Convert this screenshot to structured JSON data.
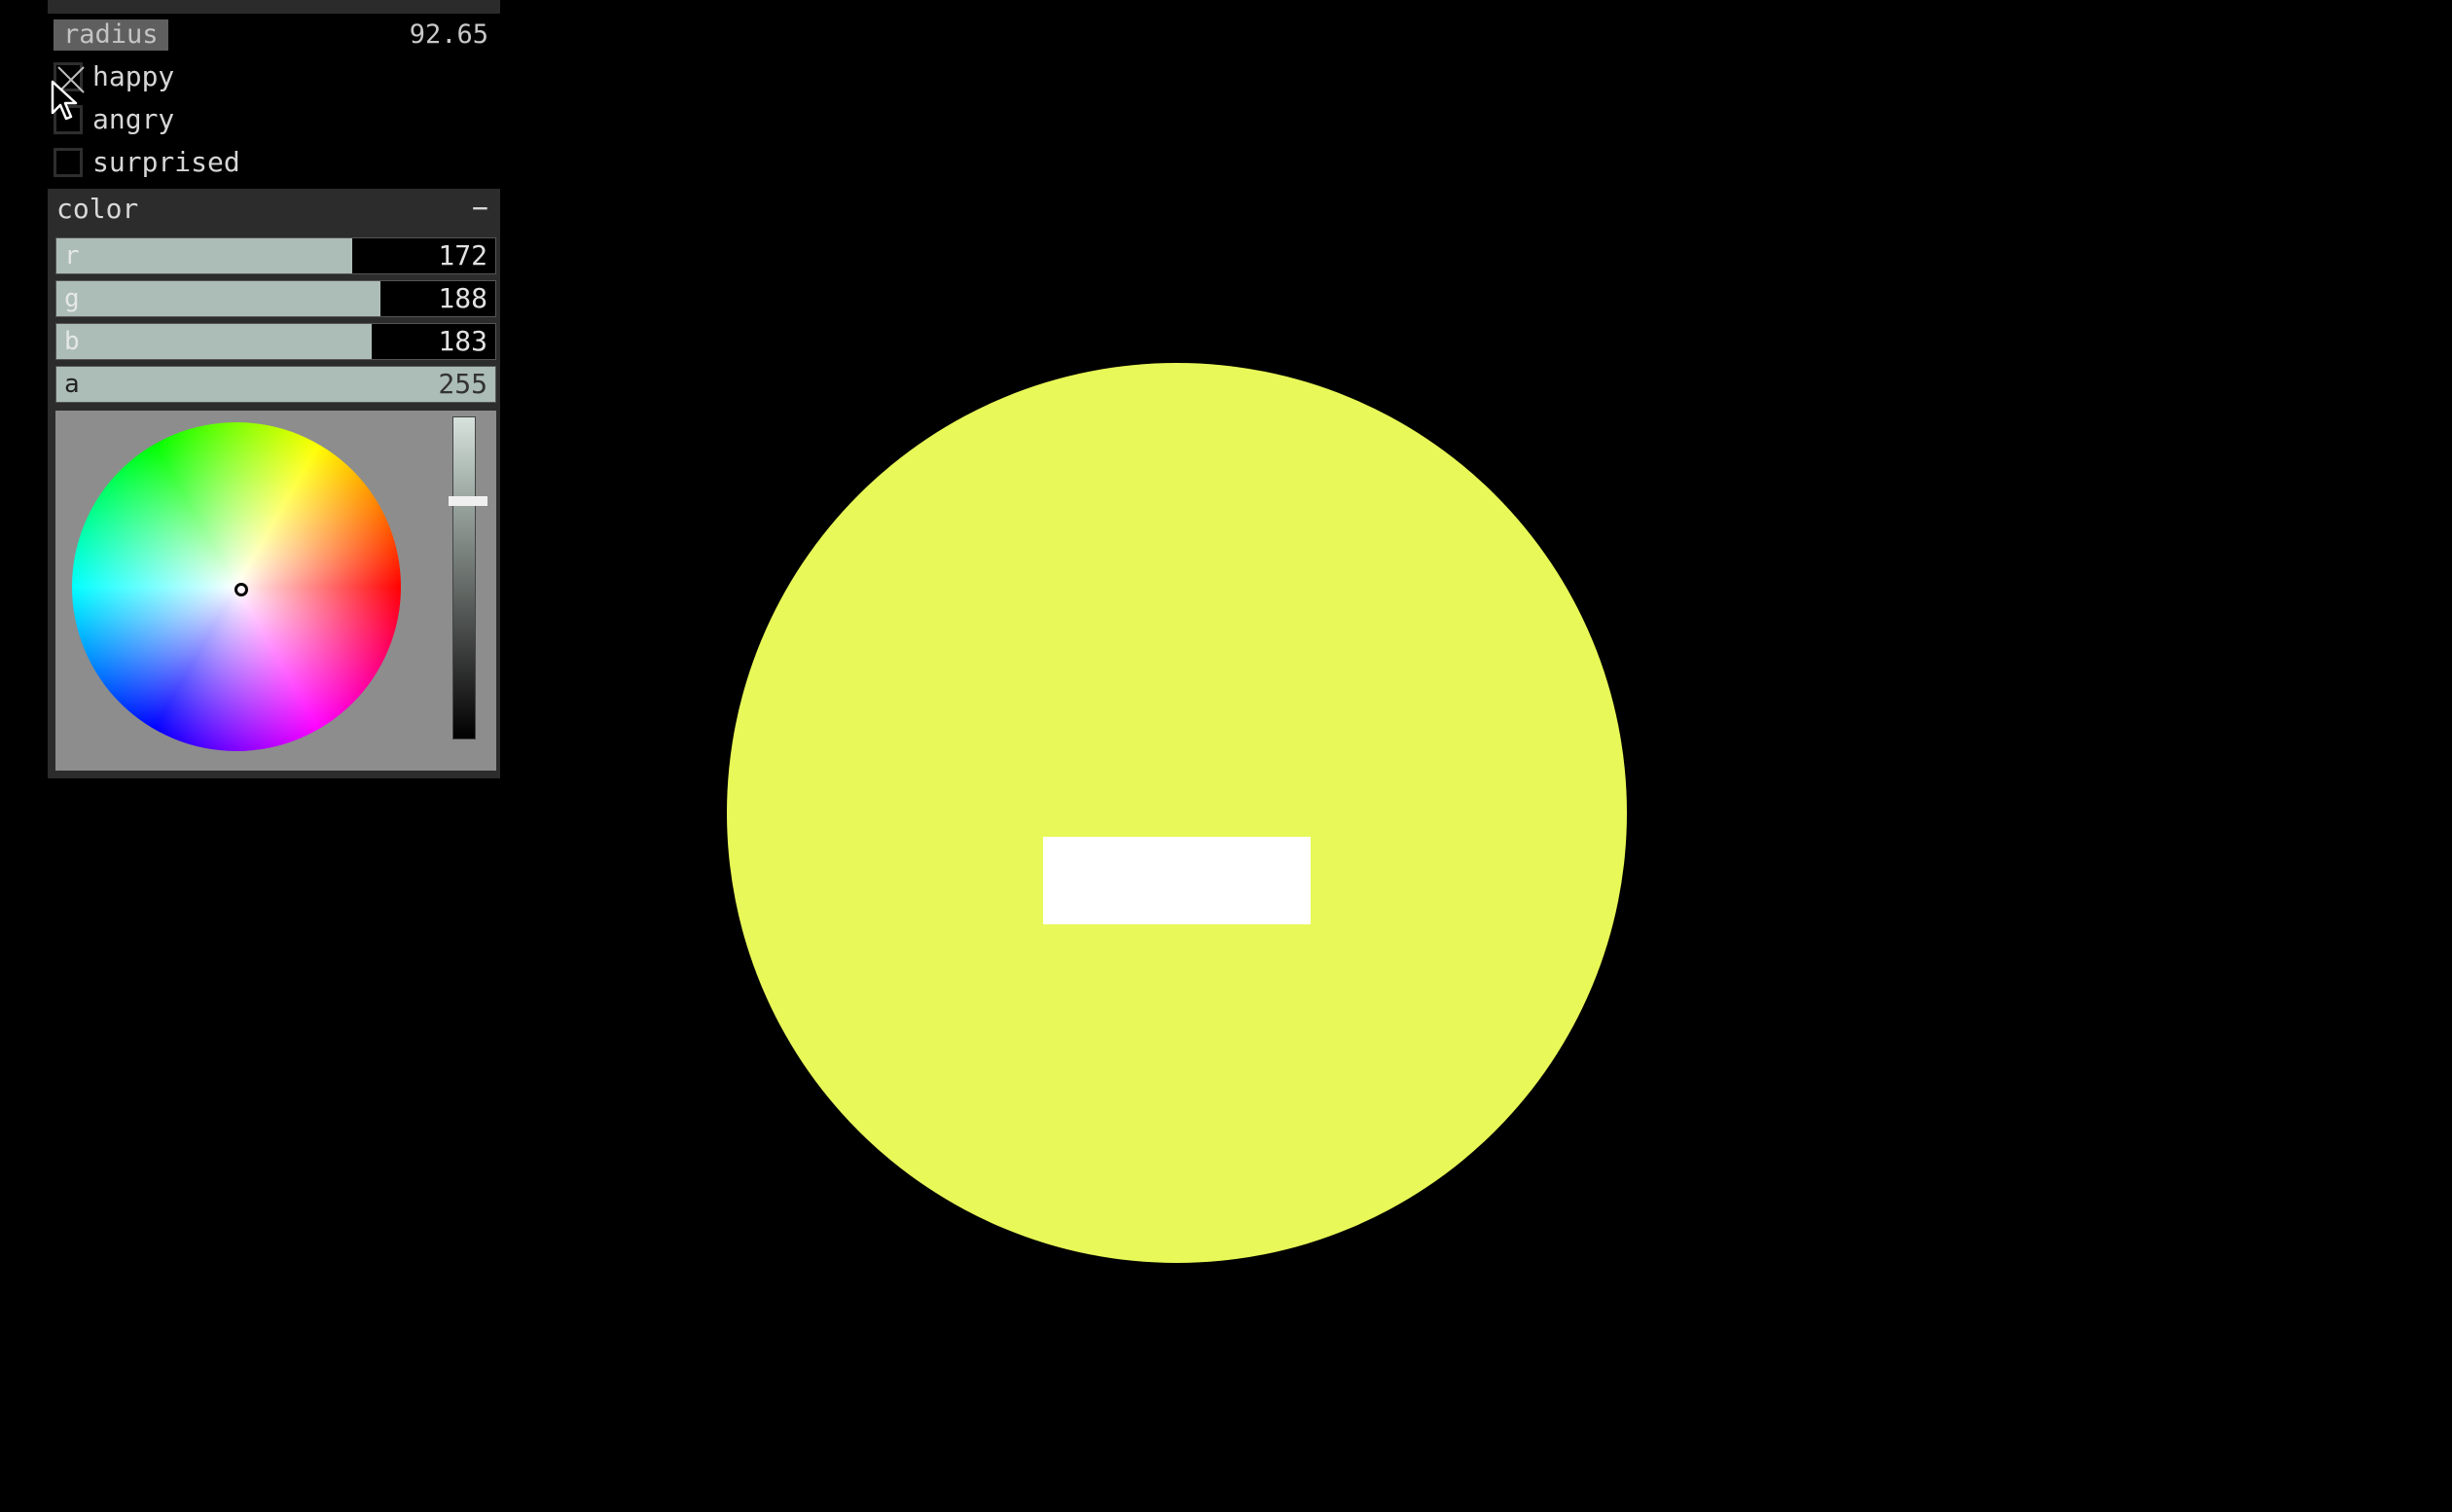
{
  "gui": {
    "radius": {
      "label": "radius",
      "value": "92.65"
    },
    "toggles": [
      {
        "label": "happy",
        "checked": true
      },
      {
        "label": "angry",
        "checked": false
      },
      {
        "label": "surprised",
        "checked": false
      }
    ],
    "color_group": {
      "title": "color",
      "collapse_symbol": "−",
      "channels": [
        {
          "label": "r",
          "value": "172",
          "fraction": 0.6745
        },
        {
          "label": "g",
          "value": "188",
          "fraction": 0.7373
        },
        {
          "label": "b",
          "value": "183",
          "fraction": 0.7176
        },
        {
          "label": "a",
          "value": "255",
          "fraction": 1.0
        }
      ],
      "slider_color": "#acbcb7"
    }
  },
  "canvas": {
    "face_color": "#e8f858",
    "mouth_color": "#ffffff",
    "background": "#000000"
  },
  "icons": {
    "cursor": "mouse-pointer-icon",
    "check": "checkmark-x-icon"
  }
}
